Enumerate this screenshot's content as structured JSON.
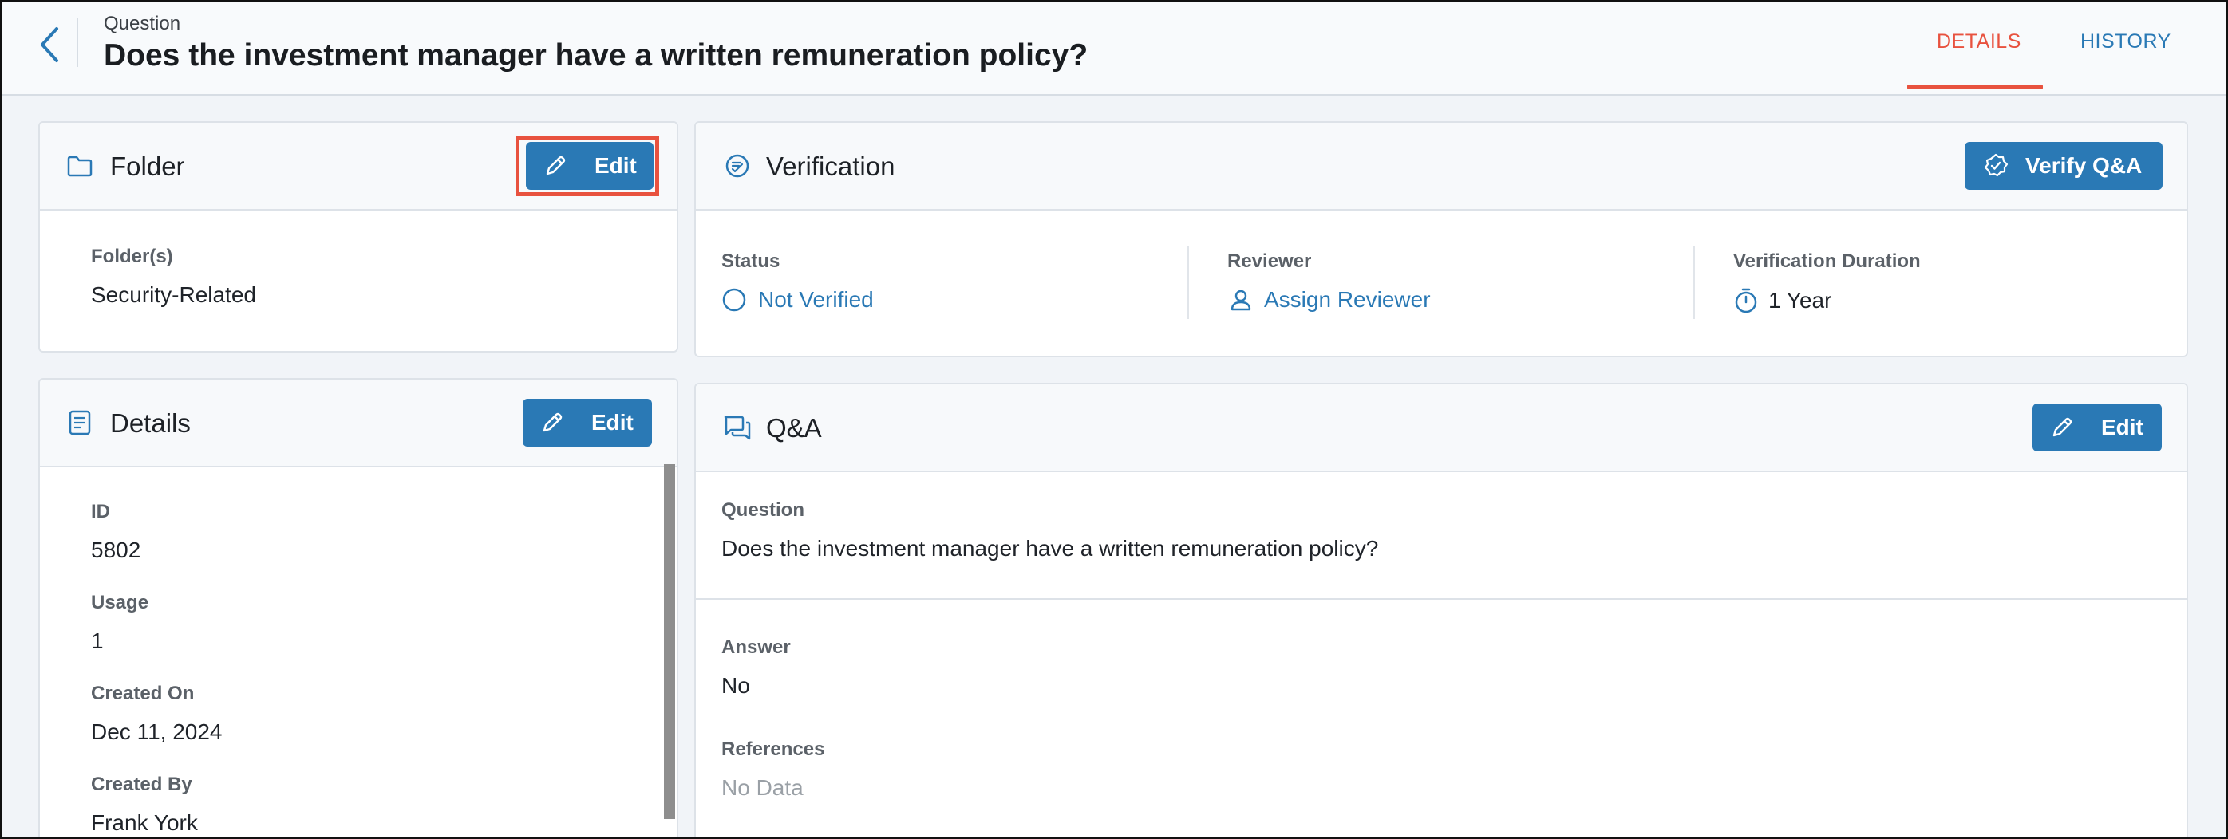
{
  "header": {
    "breadcrumb": "Question",
    "title": "Does the investment manager have a written remuneration policy?",
    "tabs": [
      {
        "label": "DETAILS",
        "active": true
      },
      {
        "label": "HISTORY",
        "active": false
      }
    ]
  },
  "folder": {
    "title": "Folder",
    "edit_label": "Edit",
    "field_label": "Folder(s)",
    "field_value": "Security-Related"
  },
  "details": {
    "title": "Details",
    "edit_label": "Edit",
    "fields": [
      {
        "label": "ID",
        "value": "5802"
      },
      {
        "label": "Usage",
        "value": "1"
      },
      {
        "label": "Created On",
        "value": "Dec 11, 2024"
      },
      {
        "label": "Created By",
        "value": "Frank York"
      }
    ]
  },
  "verification": {
    "title": "Verification",
    "verify_label": "Verify Q&A",
    "status_label": "Status",
    "status_value": "Not Verified",
    "reviewer_label": "Reviewer",
    "reviewer_value": "Assign Reviewer",
    "duration_label": "Verification Duration",
    "duration_value": "1 Year"
  },
  "qa": {
    "title": "Q&A",
    "edit_label": "Edit",
    "question_label": "Question",
    "question_value": "Does the investment manager have a written remuneration policy?",
    "answer_label": "Answer",
    "answer_value": "No",
    "references_label": "References",
    "references_value": "No Data"
  },
  "colors": {
    "accent": "#2a79b5",
    "active_tab": "#e8523f",
    "highlight": "#e8523f"
  },
  "icons": [
    "back-chevron-icon",
    "folder-icon",
    "pencil-icon",
    "details-list-icon",
    "verification-icon",
    "verified-badge-icon",
    "circle-status-icon",
    "person-icon",
    "stopwatch-icon",
    "chat-icon"
  ]
}
